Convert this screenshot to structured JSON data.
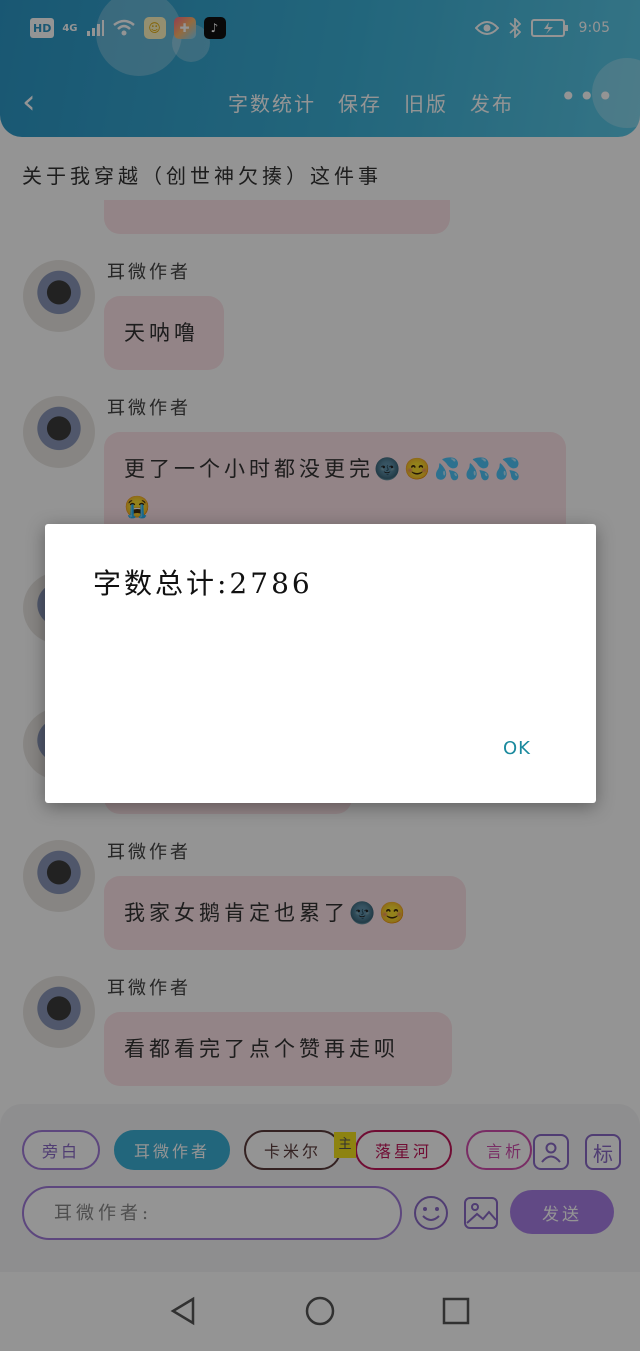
{
  "status_bar": {
    "hd_label": "HD",
    "network_label": "4G",
    "time": "9:05"
  },
  "header": {
    "actions": [
      "字数统计",
      "保存",
      "旧版",
      "发布"
    ]
  },
  "document": {
    "title": "关于我穿越（创世神欠揍）这件事"
  },
  "messages": [
    {
      "sender": "耳微作者",
      "text": "天呐噜"
    },
    {
      "sender": "耳微作者",
      "text": "更了一个小时都没更完🌚😊💦💦💦😭"
    },
    {
      "sender": "耳微作者",
      "text": "我家女鹅肯定也累了🌚😊"
    },
    {
      "sender": "耳微作者",
      "text": "看都看完了点个赞再走呗"
    }
  ],
  "composer": {
    "chips": [
      "旁白",
      "耳微作者",
      "卡米尔",
      "落星河",
      "言析"
    ],
    "tag_mark": "主",
    "input_placeholder": "耳微作者:",
    "send_label": "发送",
    "tag_button_label": "标"
  },
  "dialog": {
    "message": "字数总计:2786",
    "ok_label": "OK"
  },
  "colors": {
    "header": "#3cb0d6",
    "bubble": "#fde3e8",
    "accent": "#a87fe6",
    "dialog_ok": "#1b8a9e"
  }
}
